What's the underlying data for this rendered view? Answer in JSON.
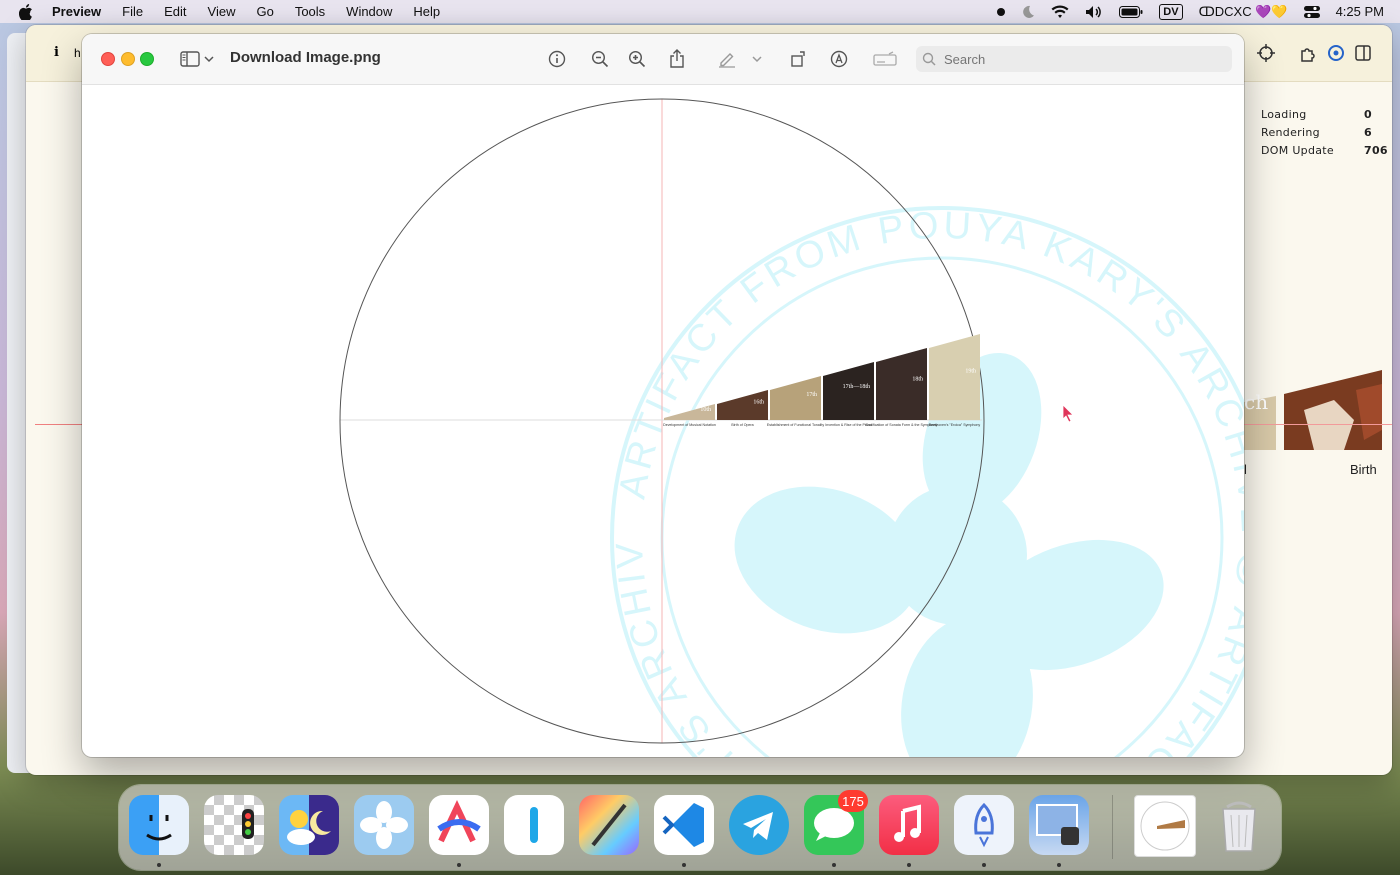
{
  "menubar": {
    "app_name": "Preview",
    "items": [
      "File",
      "Edit",
      "View",
      "Go",
      "Tools",
      "Window",
      "Help"
    ],
    "user_label": "ↀDCXC 💜💛",
    "clock": "4:25 PM",
    "display_badge": "DV"
  },
  "background_window": {
    "toolbar_fragment_i": "i",
    "toolbar_fragment_h": "h",
    "perf": {
      "loading_label": "Loading",
      "loading_value": "0",
      "rendering_label": "Rendering",
      "rendering_value": "6",
      "dom_label": "DOM Update",
      "dom_value": "706"
    },
    "partial_text_left": "l",
    "partial_text_birth": "Birth",
    "photo_fragment": "ch"
  },
  "preview_window": {
    "document_title": "Download Image.png",
    "search_placeholder": "Search"
  },
  "figure": {
    "watermark_text": "ARTIFACT FROM POUYA KARY'S ARCHIVE ꩜ ARTIFACT FROM POUYA KARY'S ARCHIVE ꩜",
    "segments": [
      {
        "century": "10th",
        "caption": "Development of Musical Notation"
      },
      {
        "century": "16th",
        "caption": "Birth of Opera"
      },
      {
        "century": "17th",
        "caption": "Establishment of Functional Tonality"
      },
      {
        "century": "17th—18th",
        "caption": "Invention & Rise of the Piano"
      },
      {
        "century": "18th",
        "caption": "Codification of Sonata Form & the Symphony"
      },
      {
        "century": "19th",
        "caption": "Beethoven's \"Eroica\" Symphony"
      }
    ]
  },
  "dock": {
    "apps": [
      "finder-icon",
      "checker-app-icon",
      "weather-night-icon",
      "pinwheel-app-icon",
      "arc-app-icon",
      "text-app-icon",
      "pixelmator-icon",
      "vscode-icon",
      "telegram-icon",
      "messages-icon",
      "music-icon",
      "rocket-app-icon",
      "preview-app-icon",
      "document-icon",
      "trash-icon"
    ],
    "messages_badge": "175"
  },
  "colors": {
    "watermark": "#d6f6fb",
    "circle_stroke": "#555555",
    "crosshair": "#f4b4b4"
  }
}
